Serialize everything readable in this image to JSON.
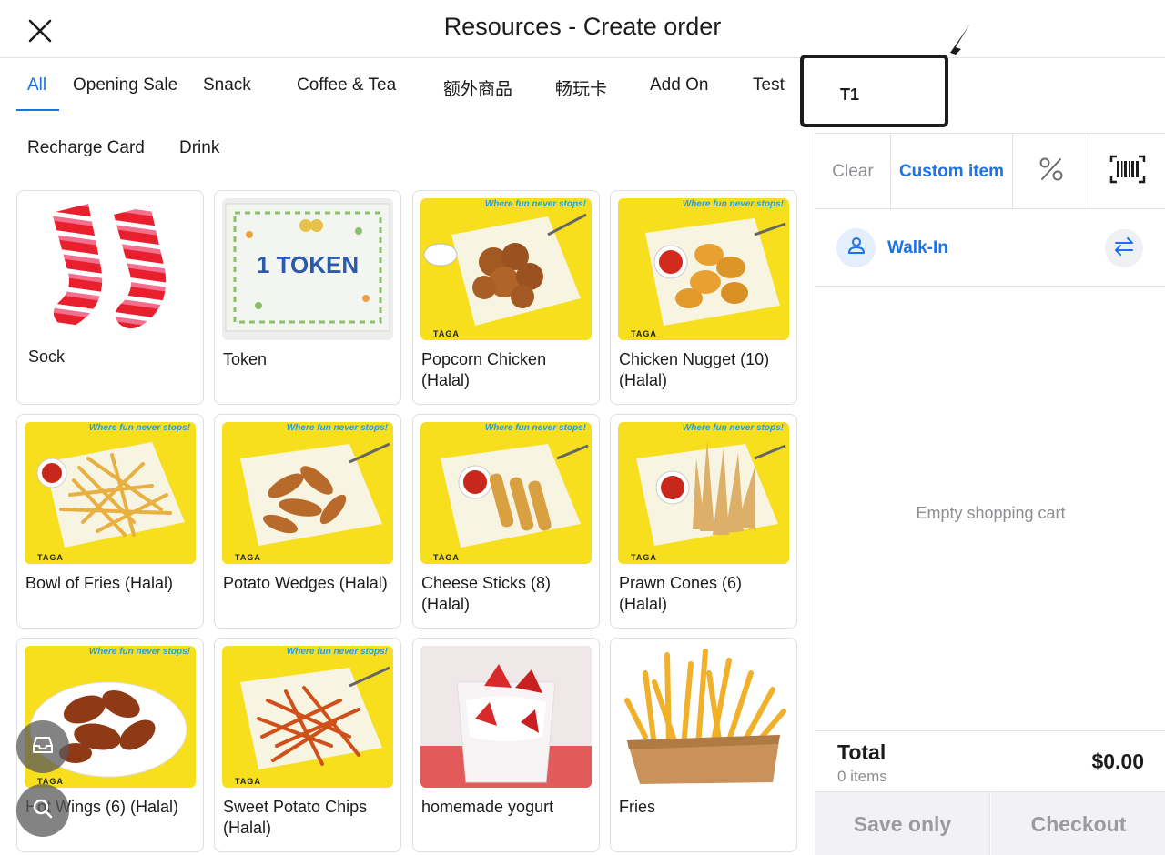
{
  "header": {
    "title": "Resources - Create order"
  },
  "categories": {
    "row1": [
      "All",
      "Opening Sale",
      "Snack",
      "Coffee & Tea",
      "额外商品",
      "畅玩卡",
      "Add On",
      "Test"
    ],
    "row2": [
      "Recharge Card",
      "Drink"
    ],
    "active": "All"
  },
  "products": [
    {
      "name": "Sock",
      "image": "socks-image"
    },
    {
      "name": "Token",
      "image": "token-card-image",
      "image_text": "1 TOKEN"
    },
    {
      "name": "Popcorn Chicken (Halal)",
      "image": "popcorn-chicken-image"
    },
    {
      "name": "Chicken Nugget (10) (Halal)",
      "image": "chicken-nugget-image"
    },
    {
      "name": "Bowl of Fries (Halal)",
      "image": "fries-basket-image"
    },
    {
      "name": "Potato Wedges (Halal)",
      "image": "potato-wedges-image"
    },
    {
      "name": "Cheese Sticks (8) (Halal)",
      "image": "cheese-sticks-image"
    },
    {
      "name": "Prawn Cones (6) (Halal)",
      "image": "prawn-cones-image"
    },
    {
      "name": "Hot Wings (6) (Halal)",
      "image": "hot-wings-image"
    },
    {
      "name": "Sweet Potato Chips (Halal)",
      "image": "sweet-potato-chips-image"
    },
    {
      "name": "homemade yogurt",
      "image": "yogurt-image"
    },
    {
      "name": "Fries",
      "image": "fries-box-image"
    }
  ],
  "photo_text": {
    "tagline": "Where fun never stops!",
    "brand": "TAGA"
  },
  "order": {
    "table": "T1",
    "clear_label": "Clear",
    "custom_item_label": "Custom item",
    "customer": "Walk-In",
    "empty_message": "Empty shopping cart",
    "total_label": "Total",
    "item_count": "0 items",
    "total_value": "$0.00",
    "save_label": "Save only",
    "checkout_label": "Checkout"
  },
  "colors": {
    "accent": "#1a73e8",
    "photo_yellow": "#f7df1e",
    "border": "#dedee2",
    "muted": "#8e8e93"
  }
}
